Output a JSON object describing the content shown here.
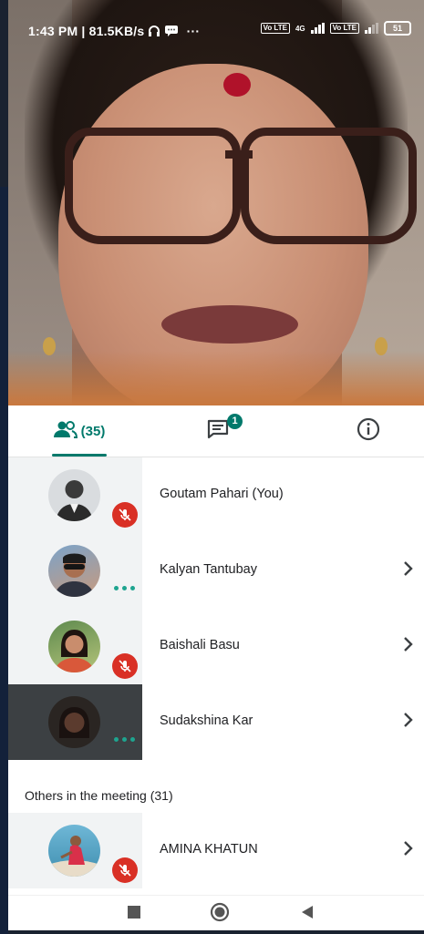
{
  "status_bar": {
    "time_text": "1:43 PM | 81.5KB/s",
    "more": "···",
    "sim1": "Vo LTE",
    "sim1_net": "4G",
    "sim2": "Vo LTE",
    "battery": "51"
  },
  "tabs": {
    "people_count": "(35)",
    "chat_badge": "1"
  },
  "participants": [
    {
      "name": "Goutam Pahari (You)",
      "state": "muted",
      "chevron": false
    },
    {
      "name": "Kalyan Tantubay",
      "state": "speaking",
      "chevron": true
    },
    {
      "name": "Baishali Basu",
      "state": "muted",
      "chevron": true
    },
    {
      "name": "Sudakshina Kar",
      "state": "speaking",
      "chevron": true,
      "highlighted": true
    }
  ],
  "others_section": {
    "title": "Others in the meeting (31)",
    "participants": [
      {
        "name": "AMINA KHATUN",
        "state": "muted",
        "chevron": true
      }
    ]
  },
  "colors": {
    "accent": "#00796b",
    "muted_red": "#d93025",
    "speaking_dots": "#1ea48f"
  }
}
